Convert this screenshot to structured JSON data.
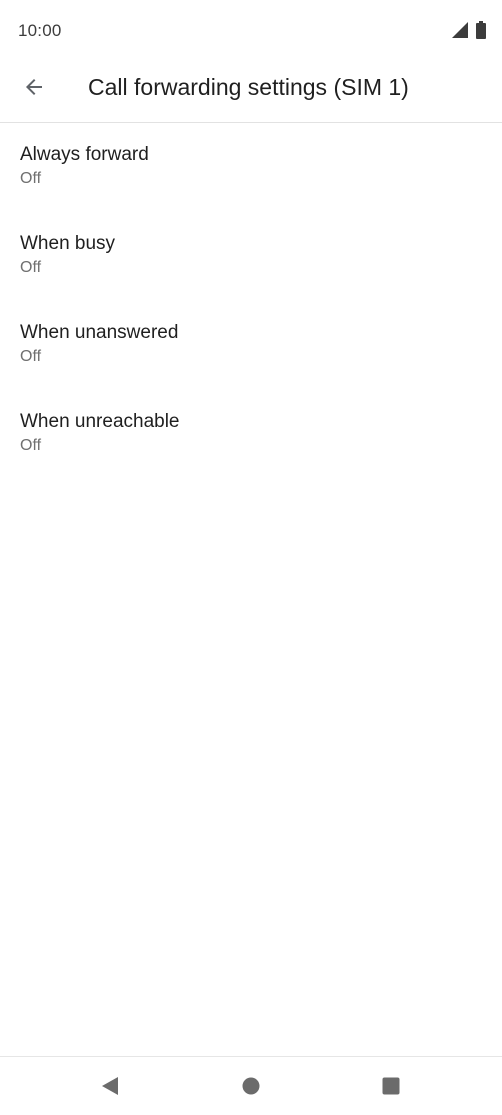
{
  "status_bar": {
    "time": "10:00",
    "icons": [
      "cellular-signal-icon",
      "battery-icon"
    ]
  },
  "app_bar": {
    "back_icon": "arrow-back-icon",
    "title": "Call forwarding settings (SIM 1)"
  },
  "settings": {
    "items": [
      {
        "title": "Always forward",
        "summary": "Off"
      },
      {
        "title": "When busy",
        "summary": "Off"
      },
      {
        "title": "When unanswered",
        "summary": "Off"
      },
      {
        "title": "When unreachable",
        "summary": "Off"
      }
    ]
  },
  "nav_bar": {
    "icons": [
      "back-triangle-icon",
      "home-circle-icon",
      "recents-square-icon"
    ]
  },
  "colors": {
    "text_primary": "#1f1f1f",
    "text_secondary": "#6f6f6f",
    "icon": "#5f6368",
    "divider": "#e2e2e2"
  }
}
